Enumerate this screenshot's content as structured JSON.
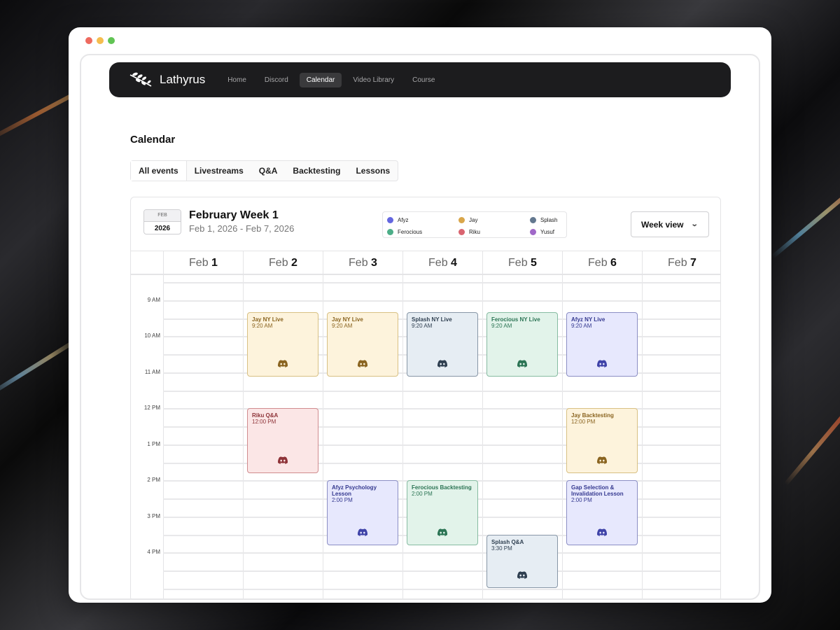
{
  "app": {
    "brand": "Lathyrus",
    "nav": [
      "Home",
      "Discord",
      "Calendar",
      "Video Library",
      "Course"
    ],
    "active_nav": "Calendar"
  },
  "page": {
    "title": "Calendar",
    "tabs": [
      "All events",
      "Livestreams",
      "Q&A",
      "Backtesting",
      "Lessons"
    ],
    "active_tab": "All events"
  },
  "calendar": {
    "badge_month": "FEB",
    "badge_year": "2026",
    "week_title": "February Week 1",
    "week_range": "Feb 1, 2026 - Feb 7, 2026",
    "view_label": "Week view",
    "days": [
      {
        "mon": "Feb",
        "num": "1"
      },
      {
        "mon": "Feb",
        "num": "2"
      },
      {
        "mon": "Feb",
        "num": "3"
      },
      {
        "mon": "Feb",
        "num": "4"
      },
      {
        "mon": "Feb",
        "num": "5"
      },
      {
        "mon": "Feb",
        "num": "6"
      },
      {
        "mon": "Feb",
        "num": "7"
      }
    ],
    "time_labels": [
      "9 AM",
      "10 AM",
      "11 AM",
      "12 PM",
      "1 PM",
      "2 PM",
      "3 PM",
      "4 PM"
    ]
  },
  "legend": [
    {
      "name": "Afyz",
      "color": "#6467e0"
    },
    {
      "name": "Jay",
      "color": "#d9a64a"
    },
    {
      "name": "Splash",
      "color": "#63788f"
    },
    {
      "name": "Ferocious",
      "color": "#4cae88"
    },
    {
      "name": "Riku",
      "color": "#d96470"
    },
    {
      "name": "Yusuf",
      "color": "#a068c8"
    }
  ],
  "hosts": {
    "Afyz": {
      "bg": "#e7e8fd",
      "border": "#8b8ec4",
      "text": "#353990",
      "icon": "#3f43a8"
    },
    "Jay": {
      "bg": "#fdf3dc",
      "border": "#d8c083",
      "text": "#8a6420",
      "icon": "#8a6420"
    },
    "Splash": {
      "bg": "#e6edf3",
      "border": "#8796a6",
      "text": "#2f3f50",
      "icon": "#2f3f50"
    },
    "Ferocious": {
      "bg": "#e2f3ea",
      "border": "#86bba1",
      "text": "#2b7454",
      "icon": "#2b7454"
    },
    "Riku": {
      "bg": "#fbe6e6",
      "border": "#d08b8e",
      "text": "#8e3338",
      "icon": "#8e3338"
    }
  },
  "events": [
    {
      "host": "Jay",
      "day": 1,
      "start": 9.33,
      "duration": 1.5,
      "title": "Jay NY Live",
      "time": "9:20 AM",
      "icon": "discord-icon"
    },
    {
      "host": "Jay",
      "day": 2,
      "start": 9.33,
      "duration": 1.5,
      "title": "Jay NY Live",
      "time": "9:20 AM",
      "icon": "discord-icon"
    },
    {
      "host": "Splash",
      "day": 3,
      "start": 9.33,
      "duration": 1.5,
      "title": "Splash NY Live",
      "time": "9:20 AM",
      "icon": "discord-icon"
    },
    {
      "host": "Ferocious",
      "day": 4,
      "start": 9.33,
      "duration": 1.5,
      "title": "Ferocious NY Live",
      "time": "9:20 AM",
      "icon": "discord-icon"
    },
    {
      "host": "Afyz",
      "day": 5,
      "start": 9.33,
      "duration": 1.5,
      "title": "Afyz NY Live",
      "time": "9:20 AM",
      "icon": "discord-icon"
    },
    {
      "host": "Riku",
      "day": 1,
      "start": 12,
      "duration": 1.5,
      "title": "Riku Q&A",
      "time": "12:00 PM",
      "icon": "discord-icon"
    },
    {
      "host": "Jay",
      "day": 5,
      "start": 12,
      "duration": 1.5,
      "title": "Jay Backtesting",
      "time": "12:00 PM",
      "icon": "discord-icon"
    },
    {
      "host": "Afyz",
      "day": 2,
      "start": 14,
      "duration": 1.5,
      "title": "Afyz Psychology Lesson",
      "time": "2:00 PM",
      "icon": "discord-icon"
    },
    {
      "host": "Ferocious",
      "day": 3,
      "start": 14,
      "duration": 1.5,
      "title": "Ferocious Backtesting",
      "time": "2:00 PM",
      "icon": "discord-icon"
    },
    {
      "host": "Afyz",
      "day": 5,
      "start": 14,
      "duration": 1.5,
      "title": "Gap Selection & Invalidation Lesson",
      "time": "2:00 PM",
      "icon": "discord-icon"
    },
    {
      "host": "Splash",
      "day": 4,
      "start": 15.5,
      "duration": 1.2,
      "title": "Splash Q&A",
      "time": "3:30 PM",
      "icon": "discord-icon"
    }
  ]
}
